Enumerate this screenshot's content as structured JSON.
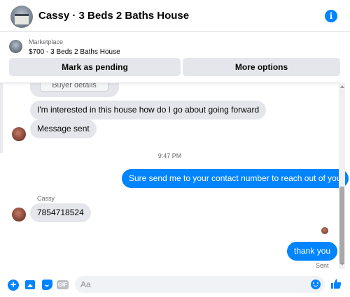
{
  "header": {
    "title": "Cassy · 3 Beds 2 Baths House",
    "info_icon": "info-icon"
  },
  "marketplace": {
    "label": "Marketplace",
    "listing": "$700 - 3 Beds 2 Baths House",
    "mark_pending_label": "Mark as pending",
    "more_options_label": "More options"
  },
  "messages": {
    "partial_card_label": "Buyer details",
    "incoming_1": "I'm interested in this house how do I go about going forward",
    "incoming_2": "Message sent",
    "timestamp": "9:47 PM",
    "outgoing_1": "Sure send me to your contact number to reach out of you",
    "sender_name": "Cassy",
    "incoming_3": "7854718524",
    "outgoing_2": "thank you",
    "status": "Sent"
  },
  "composer": {
    "placeholder": "Aa",
    "gif_label": "GIF",
    "icons": [
      "plus-icon",
      "photo-icon",
      "sticker-icon",
      "gif-icon",
      "emoji-icon",
      "like-icon"
    ]
  },
  "colors": {
    "accent": "#0084ff",
    "bubble_gray": "#e4e6eb"
  }
}
